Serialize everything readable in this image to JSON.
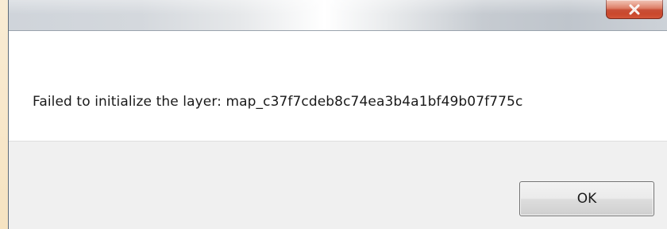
{
  "dialog": {
    "title": "",
    "close_icon": "close-icon",
    "message": "Failed to initialize the layer: map_c37f7cdeb8c74ea3b4a1bf49b07f775c",
    "ok_label": "OK"
  },
  "colors": {
    "close_button": "#c23a1f",
    "content_background": "#ffffff",
    "footer_background": "#f0f0f0"
  }
}
